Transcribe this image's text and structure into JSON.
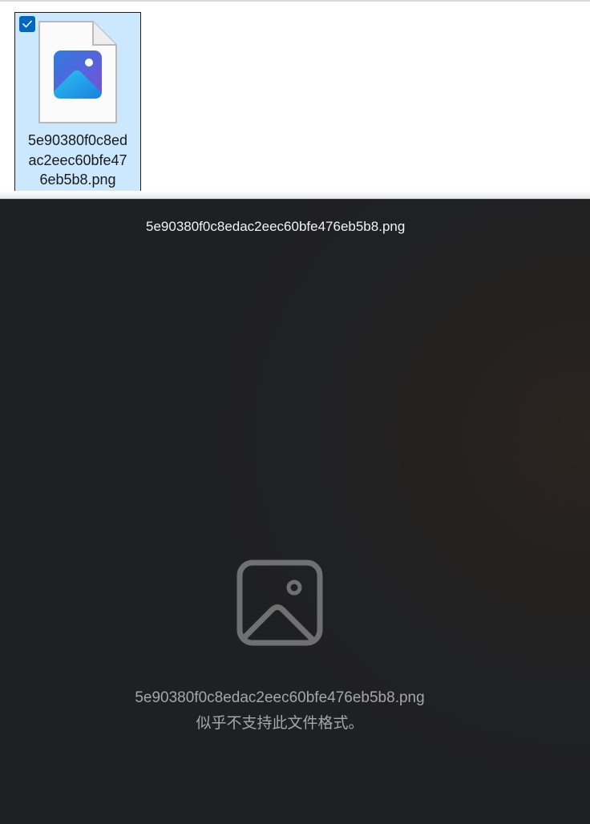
{
  "explorer": {
    "file": {
      "name": "5e90380f0c8ed\nac2eec60bfe47\n6eb5b8.png",
      "selected": true,
      "icon": "image-file-icon"
    }
  },
  "viewer": {
    "title": "5e90380f0c8edac2eec60bfe476eb5b8.png",
    "placeholder_icon": "image-placeholder-icon",
    "message_filename": "5e90380f0c8edac2eec60bfe476eb5b8.png",
    "message_text": "似乎不支持此文件格式。"
  },
  "colors": {
    "selection_bg": "#cce8ff",
    "checkbox": "#0067c0",
    "viewer_bg": "#202124",
    "message_text": "#a6a6a6"
  }
}
